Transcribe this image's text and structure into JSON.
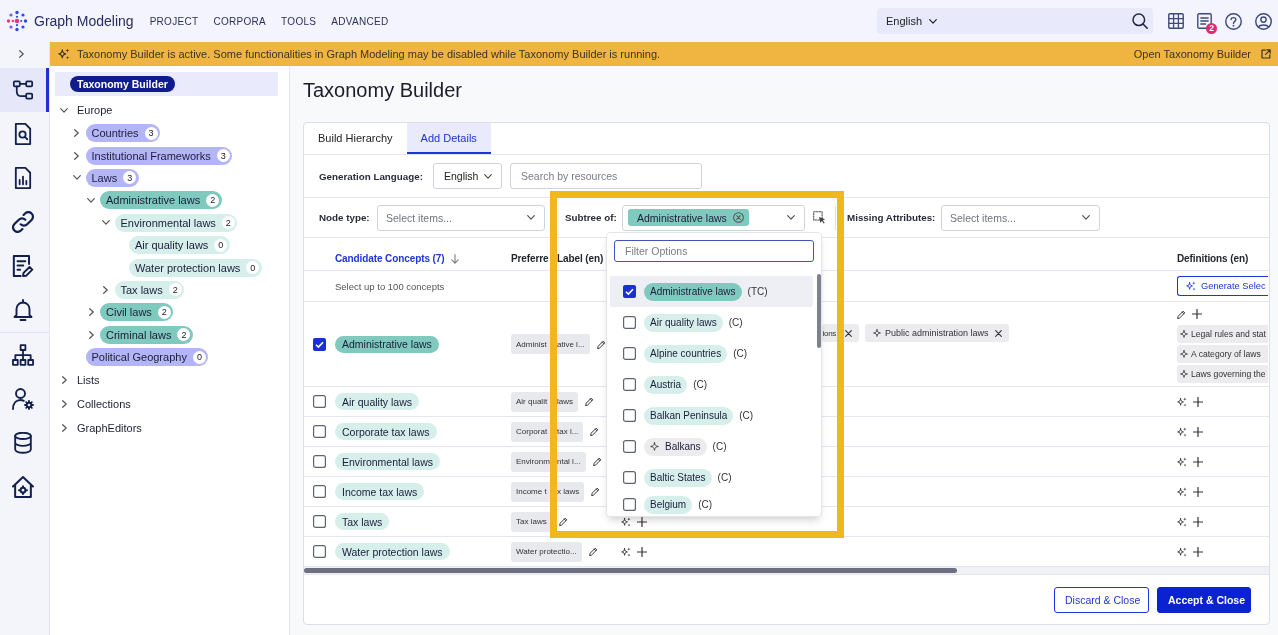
{
  "header": {
    "app_name": "Graph Modeling",
    "nav": [
      "PROJECT",
      "CORPORA",
      "TOOLS",
      "ADVANCED"
    ],
    "language": "English",
    "notification_count": "2"
  },
  "banner": {
    "message": "Taxonomy Builder is active. Some functionalities in Graph Modeling may be disabled while Taxonomy Builder is running.",
    "link": "Open Taxonomy Builder"
  },
  "rail": {
    "items": [
      {
        "selected": true
      },
      {
        "selected": false
      },
      {
        "selected": false
      },
      {
        "selected": false
      },
      {
        "selected": false
      },
      {
        "selected": false
      },
      {
        "selected": false
      },
      {
        "selected": false
      },
      {
        "selected": false
      },
      {
        "selected": false
      }
    ]
  },
  "tree": {
    "root": {
      "label": "Taxonomy Builder",
      "selected": true
    },
    "groups": [
      {
        "label": "Europe",
        "expanded": true,
        "children": [
          {
            "label": "Countries",
            "count": "3",
            "color": "#b4b5f6",
            "expanded": false
          },
          {
            "label": "Institutional Frameworks",
            "count": "3",
            "color": "#b4b5f6",
            "expanded": false
          },
          {
            "label": "Laws",
            "count": "3",
            "color": "#b4b5f6",
            "expanded": true,
            "children": [
              {
                "label": "Administrative laws",
                "count": "2",
                "color": "#80c9be",
                "expanded": true,
                "children": [
                  {
                    "label": "Environmental laws",
                    "count": "2",
                    "color": "#d6efeb",
                    "expanded": true,
                    "children": [
                      {
                        "label": "Air quality laws",
                        "count": "0",
                        "color": "#d6efeb"
                      },
                      {
                        "label": "Water protection laws",
                        "count": "0",
                        "color": "#d6efeb"
                      }
                    ]
                  },
                  {
                    "label": "Tax laws",
                    "count": "2",
                    "color": "#d6efeb",
                    "expanded": false
                  }
                ]
              },
              {
                "label": "Civil laws",
                "count": "2",
                "color": "#80c9be",
                "expanded": false
              },
              {
                "label": "Criminal laws",
                "count": "2",
                "color": "#80c9be",
                "expanded": false
              }
            ]
          },
          {
            "label": "Political Geography",
            "count": "0",
            "color": "#b4b5f6"
          }
        ]
      },
      {
        "label": "Lists",
        "expanded": false
      },
      {
        "label": "Collections",
        "expanded": false
      },
      {
        "label": "GraphEditors",
        "expanded": false
      }
    ]
  },
  "builder": {
    "title": "Taxonomy Builder",
    "tabs": [
      {
        "label": "Build Hierarchy",
        "selected": false
      },
      {
        "label": "Add Details",
        "selected": true
      }
    ],
    "generation": {
      "label": "Generation Language:",
      "value": "English"
    },
    "resource_search": {
      "placeholder": "Search by resources"
    },
    "filters": {
      "node_type": {
        "label": "Node type:",
        "placeholder": "Select items..."
      },
      "subtree": {
        "label": "Subtree of:",
        "tags": [
          {
            "label": "Administrative laws",
            "color": "#80c9be"
          }
        ]
      },
      "missing_attributes": {
        "label": "Missing Attributes:",
        "placeholder": "Select items..."
      }
    },
    "table": {
      "columns": [
        {
          "label": "Candidate Concepts (7)",
          "sorted": true
        },
        {
          "label": [
            "Preferre",
            "Label (en)"
          ],
          "sorted": false
        },
        {
          "label": "Definitions (en)",
          "sorted": false
        }
      ],
      "hint": "Select up to 100 concepts",
      "generate_button": "Generate Selec",
      "rows": [
        {
          "concept": "Administrative laws",
          "color": "#80c9be",
          "checked": true,
          "preferred_label": [
            "Administ",
            "ative l..."
          ],
          "alt_labels": [
            {
              "label": "ions",
              "suggested": false
            },
            {
              "label": "Public administration laws",
              "suggested": true
            }
          ],
          "definitions": [
            {
              "text": "Legal rules and stat",
              "suggested": true
            },
            {
              "text": "A category of laws",
              "suggested": true
            },
            {
              "text": "Laws governing the",
              "suggested": true
            }
          ]
        },
        {
          "concept": "Air quality laws",
          "color": "#d6efeb",
          "checked": false,
          "preferred_label": [
            "Air qualit",
            "laws"
          ]
        },
        {
          "concept": "Corporate tax laws",
          "color": "#d6efeb",
          "checked": false,
          "preferred_label": [
            "Corporat",
            "tax l..."
          ]
        },
        {
          "concept": "Environmental laws",
          "color": "#d6efeb",
          "checked": false,
          "preferred_label": [
            "Environm",
            "ntal l..."
          ]
        },
        {
          "concept": "Income tax laws",
          "color": "#d6efeb",
          "checked": false,
          "preferred_label": [
            "Income t",
            "x laws"
          ]
        },
        {
          "concept": "Tax laws",
          "color": "#d6efeb",
          "checked": false,
          "preferred_label": [
            "Tax laws"
          ],
          "alt_label_tools": true
        },
        {
          "concept": "Water protection laws",
          "color": "#d6efeb",
          "checked": false,
          "preferred_label": [
            "Water protectio..."
          ],
          "alt_label_tools": true
        }
      ]
    },
    "dropdown": {
      "placeholder": "Filter Options",
      "options": [
        {
          "label": "Administrative laws",
          "type": "(TC)",
          "color": "#80c9be",
          "checked": true,
          "highlighted": true,
          "suggested": false
        },
        {
          "label": "Air quality laws",
          "type": "(C)",
          "color": "#d6efeb",
          "checked": false,
          "highlighted": false,
          "suggested": false
        },
        {
          "label": "Alpine countries",
          "type": "(C)",
          "color": "#d6efeb",
          "checked": false,
          "highlighted": false,
          "suggested": false
        },
        {
          "label": "Austria",
          "type": "(C)",
          "color": "#d6efeb",
          "checked": false,
          "highlighted": false,
          "suggested": false
        },
        {
          "label": "Balkan Peninsula",
          "type": "(C)",
          "color": "#d6efeb",
          "checked": false,
          "highlighted": false,
          "suggested": false
        },
        {
          "label": "Balkans",
          "type": "(C)",
          "color": "#ececef",
          "checked": false,
          "highlighted": false,
          "suggested": true
        },
        {
          "label": "Baltic States",
          "type": "(C)",
          "color": "#d6efeb",
          "checked": false,
          "highlighted": false,
          "suggested": false
        },
        {
          "label": "Belgium",
          "type": "(C)",
          "color": "#d6efeb",
          "checked": false,
          "highlighted": false,
          "suggested": false
        }
      ]
    },
    "footer": {
      "buttons": [
        {
          "label": "Discard & Close",
          "kind": "secondary"
        },
        {
          "label": "Accept & Close",
          "kind": "primary"
        }
      ]
    }
  },
  "highlight_frame": true
}
